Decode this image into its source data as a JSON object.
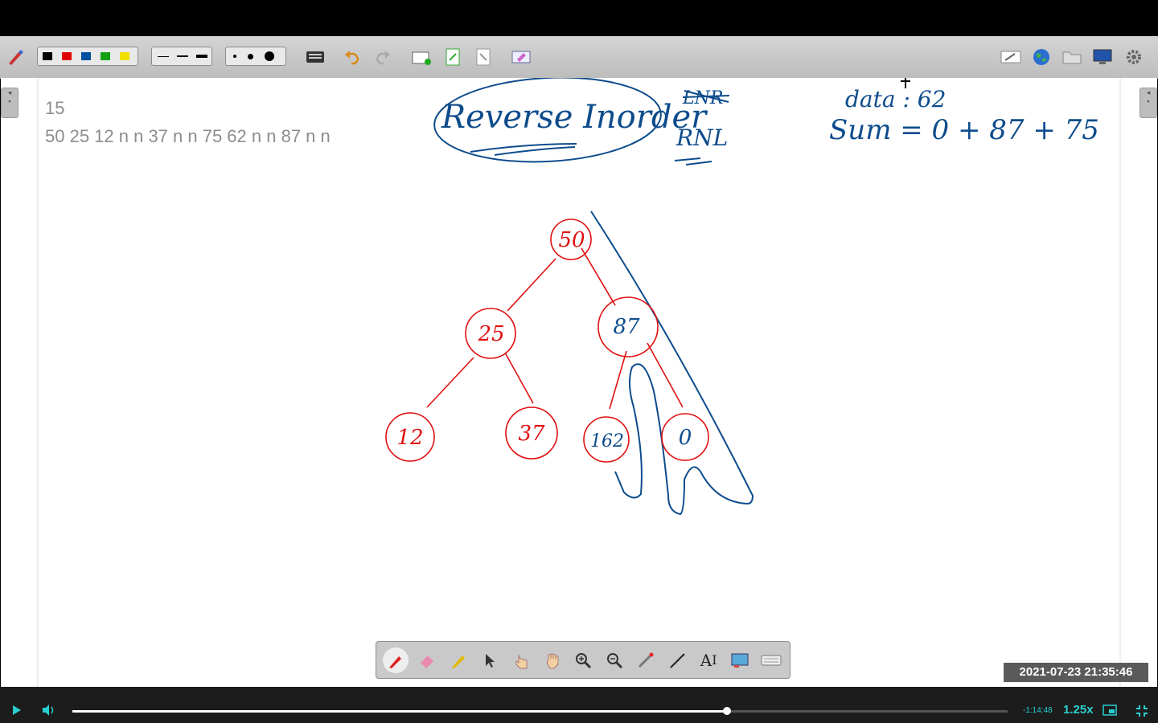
{
  "toolbar": {
    "colors": [
      "#000000",
      "#e00000",
      "#0050a0",
      "#10a010",
      "#f0e000"
    ],
    "line_widths": [
      1,
      2,
      4
    ],
    "dot_sizes": [
      4,
      7,
      12
    ]
  },
  "input_panel": {
    "line1": "15",
    "line2": "50 25 12 n n 37 n n 75 62 n n 87 n n"
  },
  "whiteboard": {
    "title": "Reverse Inorder",
    "struck": "LNR",
    "order": "RNL",
    "data_label": "data : 62",
    "sum_label": "Sum = 0 + 87 + 75",
    "nodes": [
      "50",
      "25",
      "87",
      "12",
      "37",
      "162",
      "0"
    ],
    "ink_colors": {
      "tree": "#e01010",
      "annotation": "#0d4c8c"
    }
  },
  "floating_tools": [
    "pen-icon",
    "eraser-icon",
    "highlighter-icon",
    "pointer-icon",
    "select-hand-icon",
    "pan-hand-icon",
    "zoom-in-icon",
    "zoom-out-icon",
    "laser-icon",
    "line-icon",
    "text-icon",
    "screen-icon",
    "keyboard-icon"
  ],
  "timestamp": "2021-07-23  21:35:46",
  "player": {
    "time_remaining": "-1:14:48",
    "speed": "1.25x",
    "progress": 0.7
  }
}
